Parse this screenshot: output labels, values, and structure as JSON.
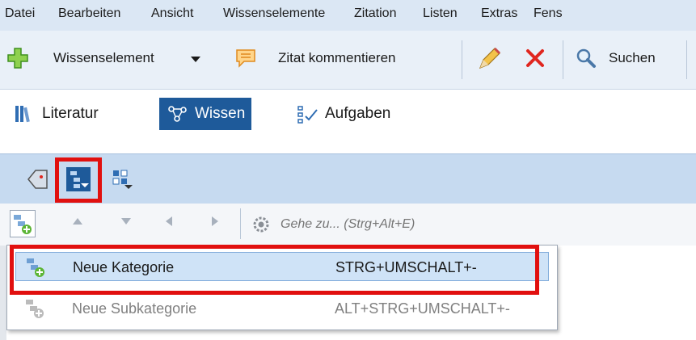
{
  "menubar": {
    "items": [
      "Datei",
      "Bearbeiten",
      "Ansicht",
      "Wissenselemente",
      "Zitation",
      "Listen",
      "Extras",
      "Fens"
    ]
  },
  "toolbar": {
    "wissenselement_label": "Wissenselement",
    "zitat_label": "Zitat kommentieren",
    "search_label": "Suchen"
  },
  "nav": {
    "literatur": "Literatur",
    "wissen": "Wissen",
    "aufgaben": "Aufgaben"
  },
  "gobar": {
    "goto_placeholder": "Gehe zu... (Strg+Alt+E)"
  },
  "dropdown": {
    "items": [
      {
        "label": "Neue Kategorie",
        "shortcut": "STRG+UMSCHALT+-",
        "enabled": true
      },
      {
        "label": "Neue Subkategorie",
        "shortcut": "ALT+STRG+UMSCHALT+-",
        "enabled": false
      }
    ]
  },
  "colors": {
    "accent": "#1e5a9a",
    "highlight": "#e1100f",
    "selected_row": "#cfe3f7"
  }
}
